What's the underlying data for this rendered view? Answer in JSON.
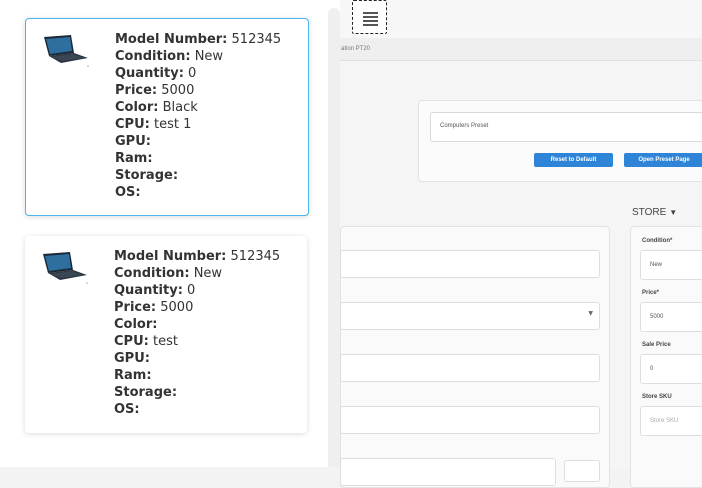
{
  "breadcrumb": "ation PT20",
  "preset": {
    "input_value": "Computers Preset",
    "reset_label": "Reset to Default",
    "open_label": "Open Preset Page"
  },
  "store_menu": {
    "label": "STORE",
    "caret": "▼"
  },
  "right_form": {
    "condition_label": "Condition*",
    "condition_value": "New",
    "price_label": "Price*",
    "price_value": "5000",
    "sale_price_label": "Sale Price",
    "sale_price_value": "0",
    "store_sku_label": "Store SKU",
    "store_sku_placeholder": "Store SKU"
  },
  "menu_button": {
    "icon": "hamburger-menu-icon"
  },
  "products": [
    {
      "model_label": "Model Number:",
      "model": "512345",
      "condition_label": "Condition:",
      "condition": "New",
      "quantity_label": "Quantity:",
      "quantity": "0",
      "price_label": "Price:",
      "price": "5000",
      "color_label": "Color:",
      "color": "Black",
      "cpu_label": "CPU:",
      "cpu": "test 1",
      "gpu_label": "GPU:",
      "gpu": "",
      "ram_label": "Ram:",
      "ram": "",
      "storage_label": "Storage:",
      "storage": "",
      "os_label": "OS:",
      "os": ""
    },
    {
      "model_label": "Model Number:",
      "model": "512345",
      "condition_label": "Condition:",
      "condition": "New",
      "quantity_label": "Quantity:",
      "quantity": "0",
      "price_label": "Price:",
      "price": "5000",
      "color_label": "Color:",
      "color": "",
      "cpu_label": "CPU:",
      "cpu": "test",
      "gpu_label": "GPU:",
      "gpu": "",
      "ram_label": "Ram:",
      "ram": "",
      "storage_label": "Storage:",
      "storage": "",
      "os_label": "OS:",
      "os": ""
    }
  ],
  "colors": {
    "selected_border": "#4ab7e8",
    "button_blue": "#2e84d6"
  }
}
